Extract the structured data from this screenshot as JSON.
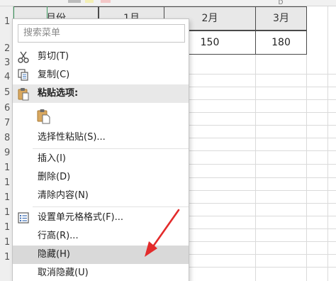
{
  "sheet": {
    "column_headers": [
      "D"
    ],
    "row_numbers": [
      "1",
      "2",
      "3",
      "4",
      "5",
      "6",
      "7",
      "8",
      "9",
      "1",
      "1",
      "1",
      "1",
      "1",
      "1",
      "1"
    ],
    "header_row": [
      "月份",
      "1月",
      "2月",
      "3月"
    ],
    "data_row": [
      "150",
      "180"
    ]
  },
  "context_menu": {
    "search_placeholder": "搜索菜单",
    "cut": "剪切(T)",
    "copy": "复制(C)",
    "paste_options": "粘贴选项:",
    "paste_special": "选择性粘贴(S)...",
    "insert": "插入(I)",
    "delete": "删除(D)",
    "clear_contents": "清除内容(N)",
    "format_cells": "设置单元格格式(F)...",
    "row_height": "行高(R)...",
    "hide": "隐藏(H)",
    "unhide": "取消隐藏(U)"
  },
  "icons": {
    "cut": "scissors-icon",
    "copy": "copy-icon",
    "paste_options": "clipboard-icon",
    "paste_option_button": "paste-icon",
    "format_cells": "format-cells-icon"
  },
  "colors": {
    "selection_border": "#3c9a5f",
    "hover_highlight": "#d9d9d9",
    "arrow": "#e32b2b",
    "header_cell_fill": "#e8e8e8"
  }
}
